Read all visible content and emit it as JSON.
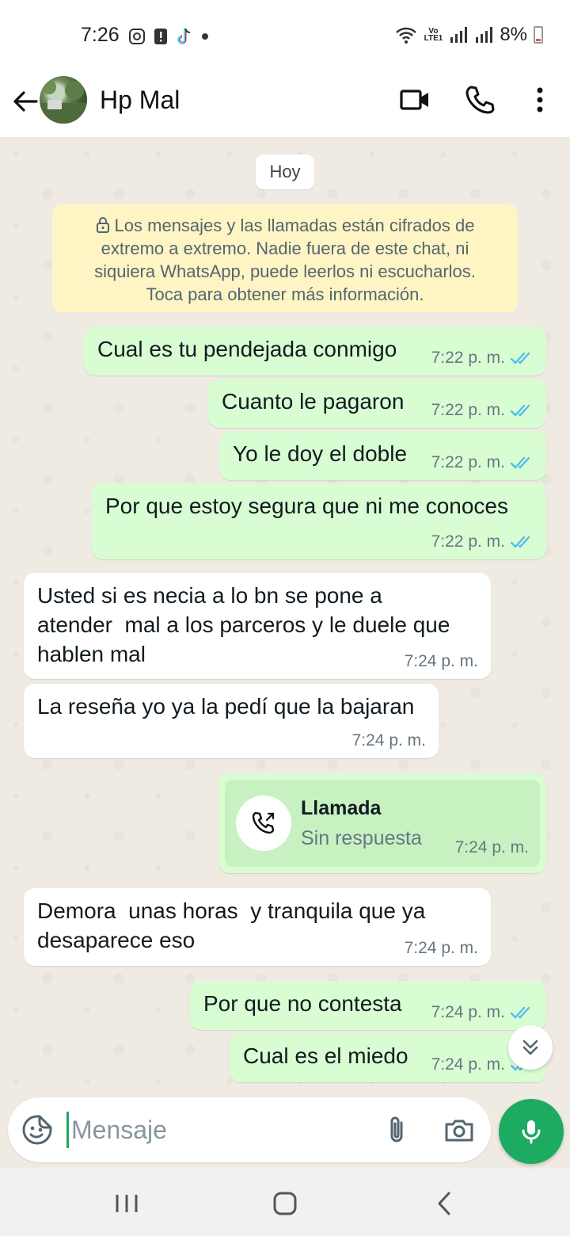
{
  "status_bar": {
    "time": "7:26",
    "lte_top": "Vo",
    "lte_bottom": "LTE1",
    "battery": "8%"
  },
  "header": {
    "contact_name": "Hp Mal",
    "icons": [
      "back-arrow-icon",
      "video-call-icon",
      "phone-call-icon",
      "more-options-icon"
    ]
  },
  "chat": {
    "date_label": "Hoy",
    "encryption_notice": "Los mensajes y las llamadas están cifrados de extremo a extremo. Nadie fuera de este chat, ni siquiera WhatsApp, puede leerlos ni escucharlos. Toca para obtener más información.",
    "encryption_lines": [
      "Los mensajes y las llamadas están cifrados de",
      "extremo a extremo. Nadie fuera de este chat, ni",
      "siquiera WhatsApp, puede leerlos ni escucharlos.",
      "Toca para obtener más información."
    ],
    "messages": [
      {
        "direction": "out",
        "text": "Cual es tu pendejada conmigo",
        "time": "7:22 p. m.",
        "read": true
      },
      {
        "direction": "out",
        "text": "Cuanto le pagaron",
        "time": "7:22 p. m.",
        "read": true
      },
      {
        "direction": "out",
        "text": "Yo le doy el doble",
        "time": "7:22 p. m.",
        "read": true
      },
      {
        "direction": "out",
        "text": "Por que estoy segura que ni me conoces",
        "time": "7:22 p. m.",
        "read": true
      },
      {
        "direction": "in",
        "text": "Usted si es necia a lo bn se pone a\natender  mal a los parceros y le duele que\nhablen mal",
        "time": "7:24 p. m."
      },
      {
        "direction": "in",
        "text": "La reseña yo ya la pedí que la bajaran",
        "time": "7:24 p. m."
      },
      {
        "direction": "out",
        "type": "call",
        "title": "Llamada",
        "subtitle": "Sin respuesta",
        "time": "7:24 p. m."
      },
      {
        "direction": "in",
        "text": "Demora  unas horas  y tranquila que ya\ndesaparece eso",
        "time": "7:24 p. m."
      },
      {
        "direction": "out",
        "text": "Por que no contesta",
        "time": "7:24 p. m.",
        "read": true
      },
      {
        "direction": "out",
        "text": "Cual es el miedo",
        "time": "7:24 p. m.",
        "read": true
      }
    ]
  },
  "composer": {
    "placeholder": "Mensaje"
  },
  "colors": {
    "outgoing_bubble": "#d9fdd3",
    "incoming_bubble": "#ffffff",
    "read_ticks": "#53bdeb",
    "accent_green": "#1daa61",
    "notice_bg": "#fff5c4"
  }
}
